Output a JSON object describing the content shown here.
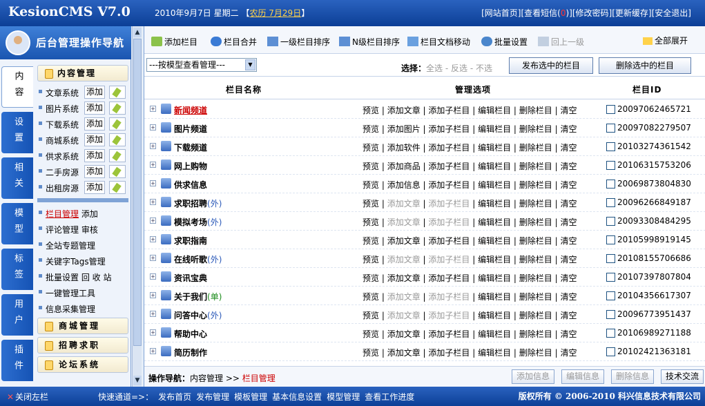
{
  "app": {
    "logo": "KesionCMS V7.0",
    "date": "2010年9月7日 星期二",
    "lunar_open": "【",
    "lunar": "农历 7月29日",
    "lunar_close": "】"
  },
  "toplinks": [
    {
      "label": "[网站首页]"
    },
    {
      "label": "[查看短信("
    },
    {
      "label": "0"
    },
    {
      "label": ")]"
    },
    {
      "label": "[修改密码]"
    },
    {
      "label": "[更新缓存]"
    },
    {
      "label": "[安全退出]"
    }
  ],
  "nav": {
    "title": "后台管理操作导航",
    "tabs": [
      "内容",
      "设置",
      "相关",
      "模型",
      "标签",
      "用户",
      "插件"
    ],
    "content_header": "内容管理",
    "content_items": [
      {
        "label": "文章系统",
        "add": "添加"
      },
      {
        "label": "图片系统",
        "add": "添加"
      },
      {
        "label": "下载系统",
        "add": "添加"
      },
      {
        "label": "商城系统",
        "add": "添加"
      },
      {
        "label": "供求系统",
        "add": "添加"
      },
      {
        "label": "二手房源",
        "add": "添加"
      },
      {
        "label": "出租房源",
        "add": "添加"
      }
    ],
    "links": [
      {
        "hl": "栏目管理",
        "rest": " 添加"
      },
      {
        "hl": "",
        "rest": "评论管理 审核"
      },
      {
        "hl": "",
        "rest": "全站专题管理"
      },
      {
        "hl": "",
        "rest": "关键字Tags管理"
      },
      {
        "hl": "",
        "rest": "批量设置 回 收 站"
      },
      {
        "hl": "",
        "rest": "一键管理工具"
      },
      {
        "hl": "",
        "rest": "信息采集管理"
      }
    ],
    "sections": [
      "商城管理",
      "招聘求职",
      "论坛系统"
    ]
  },
  "toolbar": {
    "items": [
      "添加栏目",
      "栏目合并",
      "一级栏目排序",
      "N级栏目排序",
      "栏目文档移动",
      "批量设置",
      "回上一级"
    ],
    "expand_all": "全部展开"
  },
  "filter": {
    "model_select": "---按模型查看管理---",
    "select_label": "选择：",
    "all": "全选",
    "invert": "反选",
    "none": "不选",
    "sep": " - ",
    "publish_btn": "发布选中的栏目",
    "delete_btn": "删除选中的栏目"
  },
  "table": {
    "headers": {
      "name": "栏目名称",
      "ops": "管理选项",
      "id": "栏目ID"
    },
    "rows": [
      {
        "name": "新闻频道",
        "suffix": "",
        "add": "添加文章",
        "add_enabled": true,
        "sub_enabled": true,
        "id": "20097062465721",
        "red": true
      },
      {
        "name": "图片频道",
        "suffix": "",
        "add": "添加图片",
        "add_enabled": true,
        "sub_enabled": true,
        "id": "20097082279507",
        "red": false
      },
      {
        "name": "下载频道",
        "suffix": "",
        "add": "添加软件",
        "add_enabled": true,
        "sub_enabled": true,
        "id": "20103274361542",
        "red": false
      },
      {
        "name": "网上购物",
        "suffix": "",
        "add": "添加商品",
        "add_enabled": true,
        "sub_enabled": true,
        "id": "20106315753206",
        "red": false
      },
      {
        "name": "供求信息",
        "suffix": "",
        "add": "添加信息",
        "add_enabled": true,
        "sub_enabled": true,
        "id": "20069873804830",
        "red": false
      },
      {
        "name": "求职招聘",
        "suffix": "(外)",
        "add": "添加文章",
        "add_enabled": false,
        "sub_enabled": false,
        "id": "20096266849187",
        "red": false
      },
      {
        "name": "模拟考场",
        "suffix": "(外)",
        "add": "添加文章",
        "add_enabled": false,
        "sub_enabled": false,
        "id": "20093308484295",
        "red": false
      },
      {
        "name": "求职指南",
        "suffix": "",
        "add": "添加文章",
        "add_enabled": true,
        "sub_enabled": true,
        "id": "20105998919145",
        "red": false
      },
      {
        "name": "在线听歌",
        "suffix": "(外)",
        "add": "添加文章",
        "add_enabled": false,
        "sub_enabled": false,
        "id": "20108155706686",
        "red": false
      },
      {
        "name": "资讯宝典",
        "suffix": "",
        "add": "添加文章",
        "add_enabled": true,
        "sub_enabled": true,
        "id": "20107397807804",
        "red": false
      },
      {
        "name": "关于我们",
        "suffix": "(单)",
        "add": "添加文章",
        "add_enabled": false,
        "sub_enabled": false,
        "id": "20104356617307",
        "red": false
      },
      {
        "name": "问答中心",
        "suffix": "(外)",
        "add": "添加文章",
        "add_enabled": false,
        "sub_enabled": false,
        "id": "20096773951437",
        "red": false
      },
      {
        "name": "帮助中心",
        "suffix": "",
        "add": "添加文章",
        "add_enabled": true,
        "sub_enabled": true,
        "id": "20106989271188",
        "red": false
      },
      {
        "name": "简历制作",
        "suffix": "",
        "add": "添加文章",
        "add_enabled": true,
        "sub_enabled": true,
        "id": "20102421363181",
        "red": false
      }
    ],
    "op_labels": {
      "preview": "预览",
      "sub": "添加子栏目",
      "edit": "编辑栏目",
      "del": "删除栏目",
      "clear": "清空",
      "sep": " | "
    }
  },
  "opbar": {
    "label": "操作导航：",
    "path1": "内容管理",
    "arrow": " >> ",
    "path2": "栏目管理",
    "buttons": [
      "添加信息",
      "编辑信息",
      "删除信息",
      "技术交流"
    ]
  },
  "bottom": {
    "close": "关闭左栏",
    "quick_label": "快速通道=>：",
    "quick": [
      "发布首页",
      "发布管理",
      "模板管理",
      "基本信息设置",
      "模型管理",
      "查看工作进度"
    ],
    "copyright": "版权所有 © 2006-2010 科兴信息技术有限公司"
  },
  "colors": {
    "brand": "#1a55b0",
    "highlight": "#c00000",
    "disabled": "#999999"
  }
}
